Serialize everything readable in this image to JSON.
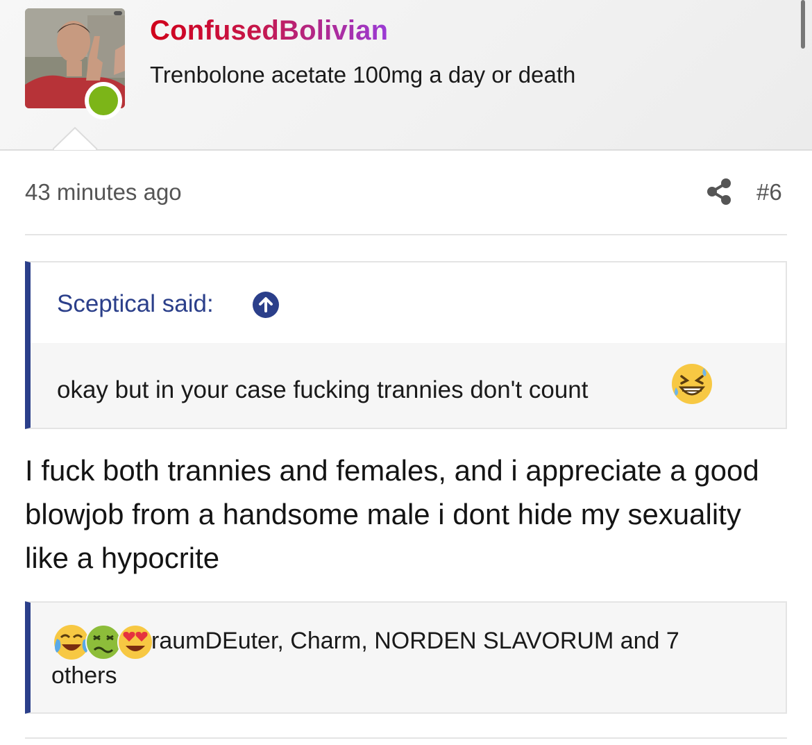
{
  "post": {
    "username": "ConfusedBolivian",
    "user_title": "Trenbolone acetate 100mg a day or death",
    "online": true,
    "timestamp": "43 minutes ago",
    "post_number": "#6",
    "share_icon": "share-icon"
  },
  "quote": {
    "author": "Sceptical said:",
    "text": "okay but in your case fucking trannies don't count",
    "emoji": "grinning-sweat-emoji",
    "arrow_icon": "arrow-up-icon"
  },
  "message": {
    "text": "I fuck both trannies and females, and i appreciate a good blowjob from a handsome male i dont hide my sexuality like a hypocrite"
  },
  "reactions": {
    "emojis": [
      "tears-of-joy-emoji",
      "nauseated-emoji",
      "heart-eyes-emoji"
    ],
    "names_line1": "raumDEuter, Charm, NORDEN SLAVORUM and 7",
    "names_line2": "others"
  },
  "colors": {
    "quote_accent": "#2b3f8a",
    "online_dot": "#7cb518",
    "username_gradient_start": "#d0001a",
    "username_gradient_end": "#9a3bd6"
  }
}
